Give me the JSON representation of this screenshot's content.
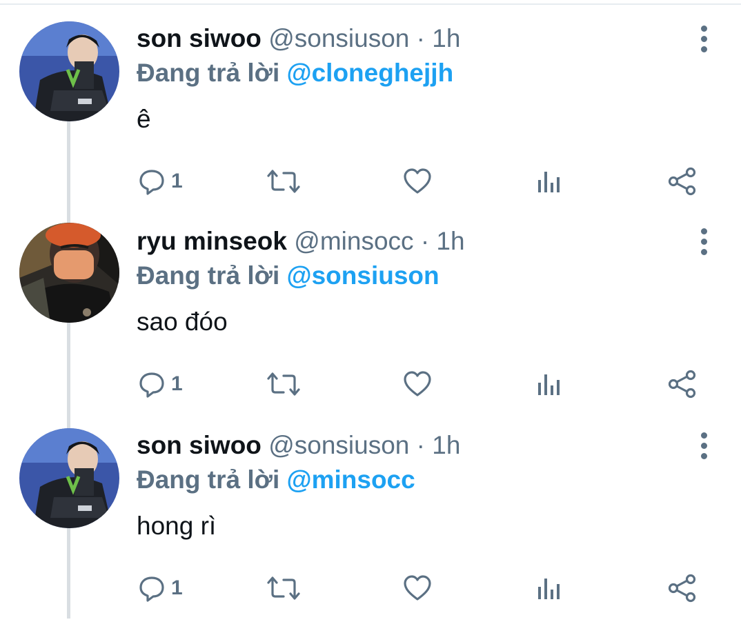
{
  "tweets": [
    {
      "name": "son siwoo",
      "handle": "@sonsiuson",
      "dot": "·",
      "time": "1h",
      "replying_prefix": "Đang trả lời",
      "replying_to": "@cloneghejjh",
      "text": "ê",
      "reply_count": "1"
    },
    {
      "name": "ryu minseok",
      "handle": "@minsocc",
      "dot": "·",
      "time": "1h",
      "replying_prefix": "Đang trả lời",
      "replying_to": "@sonsiuson",
      "text": "sao đóo",
      "reply_count": "1"
    },
    {
      "name": "son siwoo",
      "handle": "@sonsiuson",
      "dot": "·",
      "time": "1h",
      "replying_prefix": "Đang trả lời",
      "replying_to": "@minsocc",
      "text": "hong rì",
      "reply_count": "1"
    }
  ],
  "icons": {
    "reply": "reply-icon",
    "retweet": "retweet-icon",
    "like": "like-icon",
    "analytics": "analytics-icon",
    "share": "share-icon",
    "more": "more-icon"
  },
  "colors": {
    "mention": "#1da1f2",
    "secondary_text": "#5b7083",
    "primary_text": "#0f1419",
    "thread_line": "#d9dee2"
  }
}
